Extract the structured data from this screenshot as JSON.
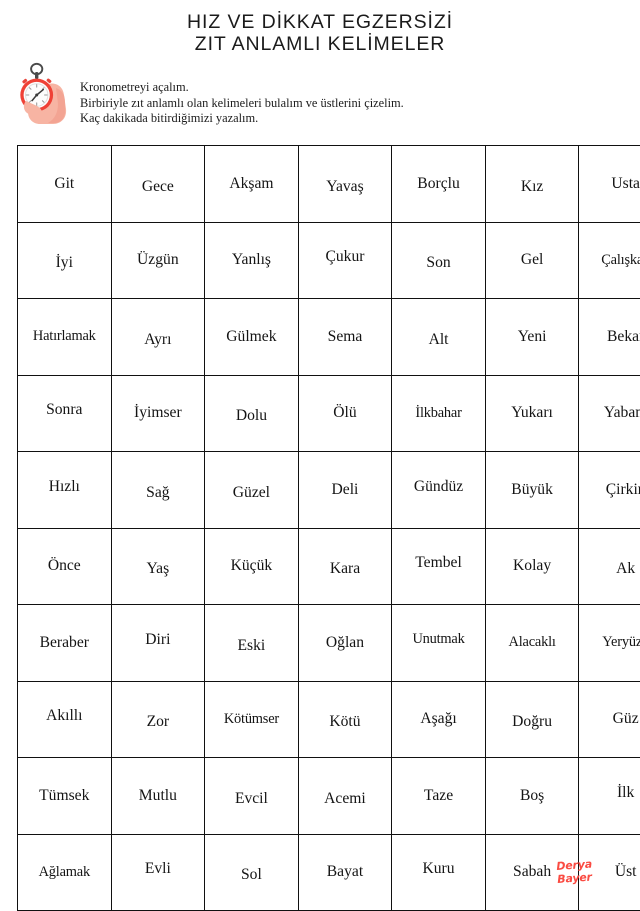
{
  "header": {
    "title_line1": "HIZ VE DİKKAT EGZERSİZİ",
    "title_line2": "ZIT ANLAMLI KELİMELER",
    "icon": "stopwatch-icon",
    "instructions": [
      "Kronometreyi açalım.",
      "Birbiriyle zıt anlamlı olan kelimeleri bulalım ve üstlerini çizelim.",
      "Kaç dakikada bitirdiğimizi yazalım."
    ],
    "answer_blank": "............................"
  },
  "grid": {
    "columns": 7,
    "rows_count": 10,
    "rows": [
      [
        "Git",
        "Gece",
        "Akşam",
        "Yavaş",
        "Borçlu",
        "Kız",
        "Usta"
      ],
      [
        "İyi",
        "Üzgün",
        "Yanlış",
        "Çukur",
        "Son",
        "Gel",
        "Çalışkan"
      ],
      [
        "Hatırlamak",
        "Ayrı",
        "Gülmek",
        "Sema",
        "Alt",
        "Yeni",
        "Bekar"
      ],
      [
        "Sonra",
        "İyimser",
        "Dolu",
        "Ölü",
        "İlkbahar",
        "Yukarı",
        "Yabani"
      ],
      [
        "Hızlı",
        "Sağ",
        "Güzel",
        "Deli",
        "Gündüz",
        "Büyük",
        "Çirkin"
      ],
      [
        "Önce",
        "Yaş",
        "Küçük",
        "Kara",
        "Tembel",
        "Kolay",
        "Ak"
      ],
      [
        "Beraber",
        "Diri",
        "Eski",
        "Oğlan",
        "Unutmak",
        "Alacaklı",
        "Yeryüzü"
      ],
      [
        "Akıllı",
        "Zor",
        "Kötümser",
        "Kötü",
        "Aşağı",
        "Doğru",
        "Güz"
      ],
      [
        "Tümsek",
        "Mutlu",
        "Evcil",
        "Acemi",
        "Taze",
        "Boş",
        "İlk"
      ],
      [
        "Ağlamak",
        "Evli",
        "Sol",
        "Bayat",
        "Kuru",
        "Sabah",
        "Üst"
      ]
    ]
  },
  "footer": {
    "signature_line1": "Derya",
    "signature_line2": "Bayer",
    "signature_color": "#fa4b42"
  }
}
